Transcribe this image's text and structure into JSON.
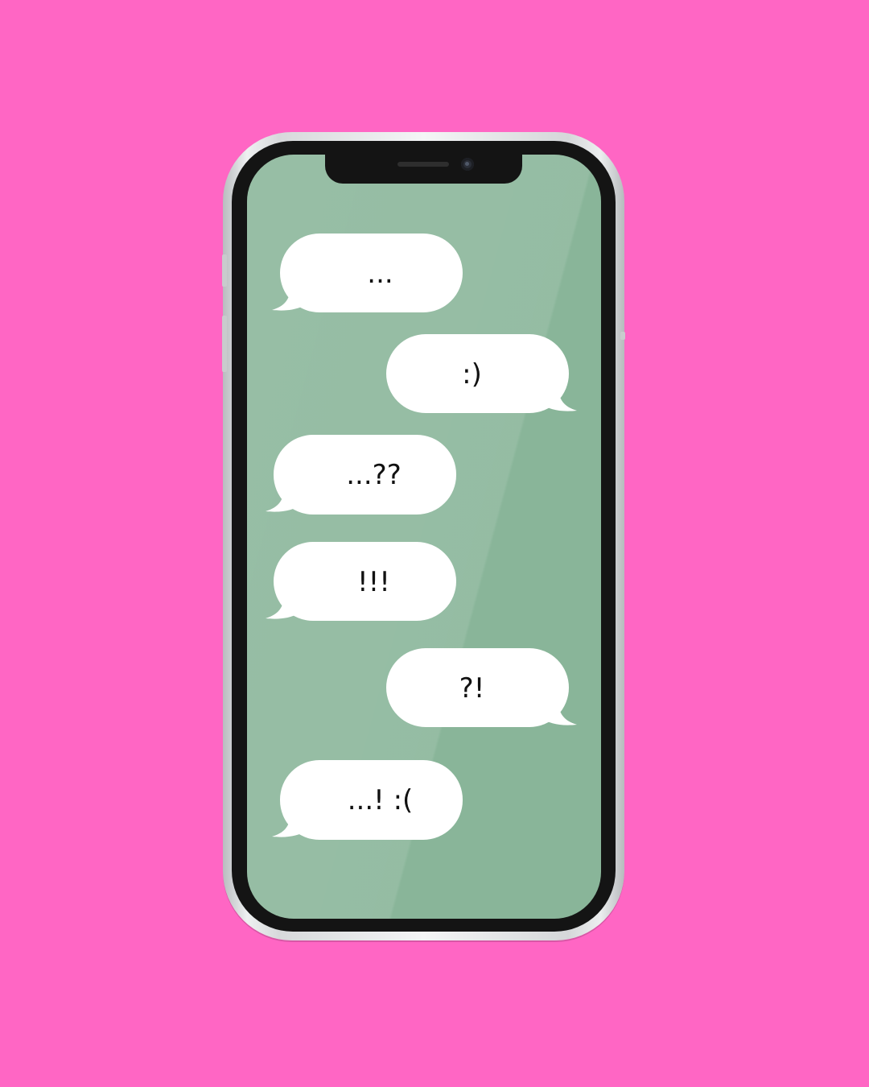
{
  "background_color": "#ff66c4",
  "screen_color": "#89b599",
  "messages": [
    {
      "text": "...",
      "side": "left"
    },
    {
      "text": ":)",
      "side": "right"
    },
    {
      "text": "...??",
      "side": "left"
    },
    {
      "text": "!!!",
      "side": "left"
    },
    {
      "text": "?!",
      "side": "right"
    },
    {
      "text": "...! :(",
      "side": "left"
    }
  ]
}
